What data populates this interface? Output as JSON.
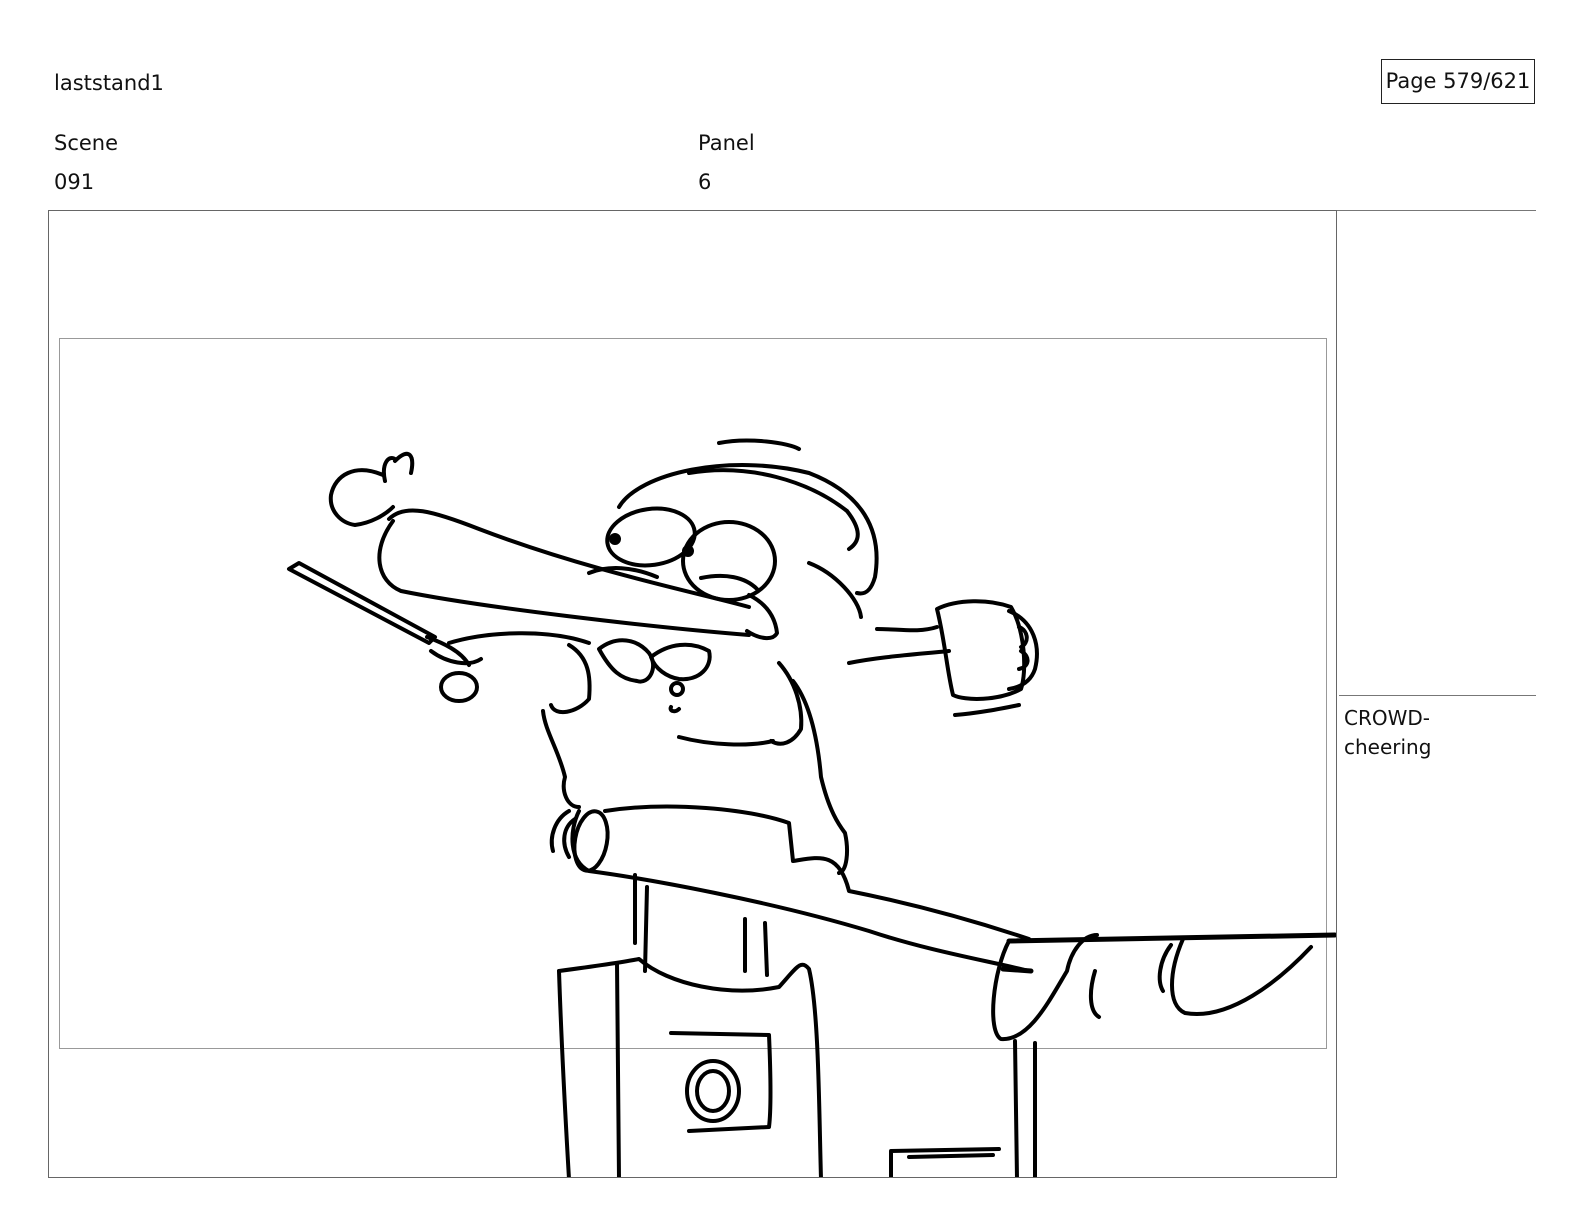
{
  "header": {
    "project": "laststand1",
    "page": "Page 579/621"
  },
  "fields": {
    "scene_label": "Scene",
    "scene_value": "091",
    "panel_label": "Panel",
    "panel_value": "6"
  },
  "panel": {
    "image": "sketch-character-on-bar-holding-sword-and-mug"
  },
  "notes": {
    "lines": [
      "CROWD-",
      "cheering"
    ]
  }
}
